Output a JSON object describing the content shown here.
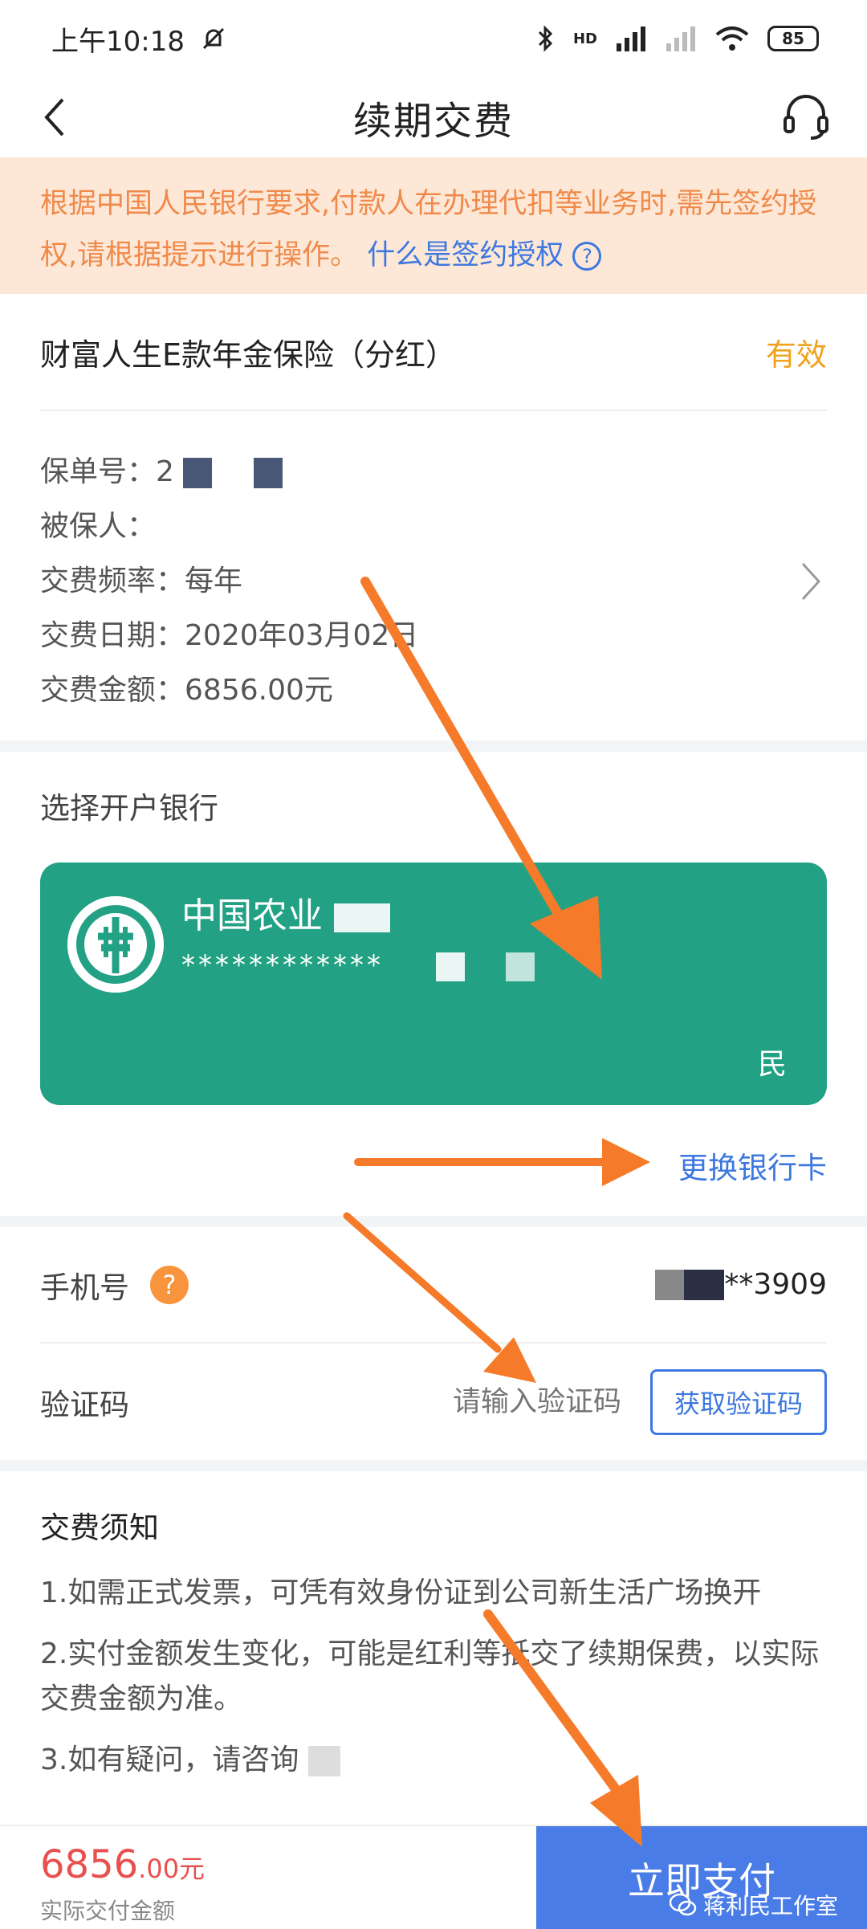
{
  "status": {
    "time": "上午10:18",
    "battery": "85",
    "network": "HD"
  },
  "nav": {
    "title": "续期交费"
  },
  "notice": {
    "text": "根据中国人民银行要求,付款人在办理代扣等业务时,需先签约授权,请根据提示进行操作。",
    "link": "什么是签约授权"
  },
  "policy": {
    "name": "财富人生E款年金保险（分红）",
    "status": "有效",
    "number_label": "保单号：",
    "number_value": "2",
    "insured_label": "被保人：",
    "frequency_label": "交费频率：",
    "frequency_value": "每年",
    "date_label": "交费日期：",
    "date_value": "2020年03月02日",
    "amount_label": "交费金额：",
    "amount_value": "6856.00元"
  },
  "bank": {
    "section_title": "选择开户银行",
    "name": "中国农业",
    "number": "************",
    "holder": "民",
    "change_label": "更换银行卡"
  },
  "phone": {
    "label": "手机号",
    "help": "?",
    "value": "**3909"
  },
  "code": {
    "label": "验证码",
    "placeholder": "请输入验证码",
    "button": "获取验证码"
  },
  "notes": {
    "title": "交费须知",
    "items": [
      "1.如需正式发票，可凭有效身份证到公司新生活广场换开",
      "2.实付金额发生变化，可能是红利等抵交了续期保费，以实际交费金额为准。",
      "3.如有疑问，请咨询"
    ]
  },
  "footer": {
    "amount_int": "6856",
    "amount_dec": ".00元",
    "amount_label": "实际交付金额",
    "pay_button": "立即支付",
    "watermark": "蒋利民工作室"
  },
  "colors": {
    "accent": "#3d77e0",
    "notice": "#f08a4b",
    "bank_card": "#23a184",
    "arrow": "#f57a2a",
    "pay": "#4a7ce8"
  }
}
